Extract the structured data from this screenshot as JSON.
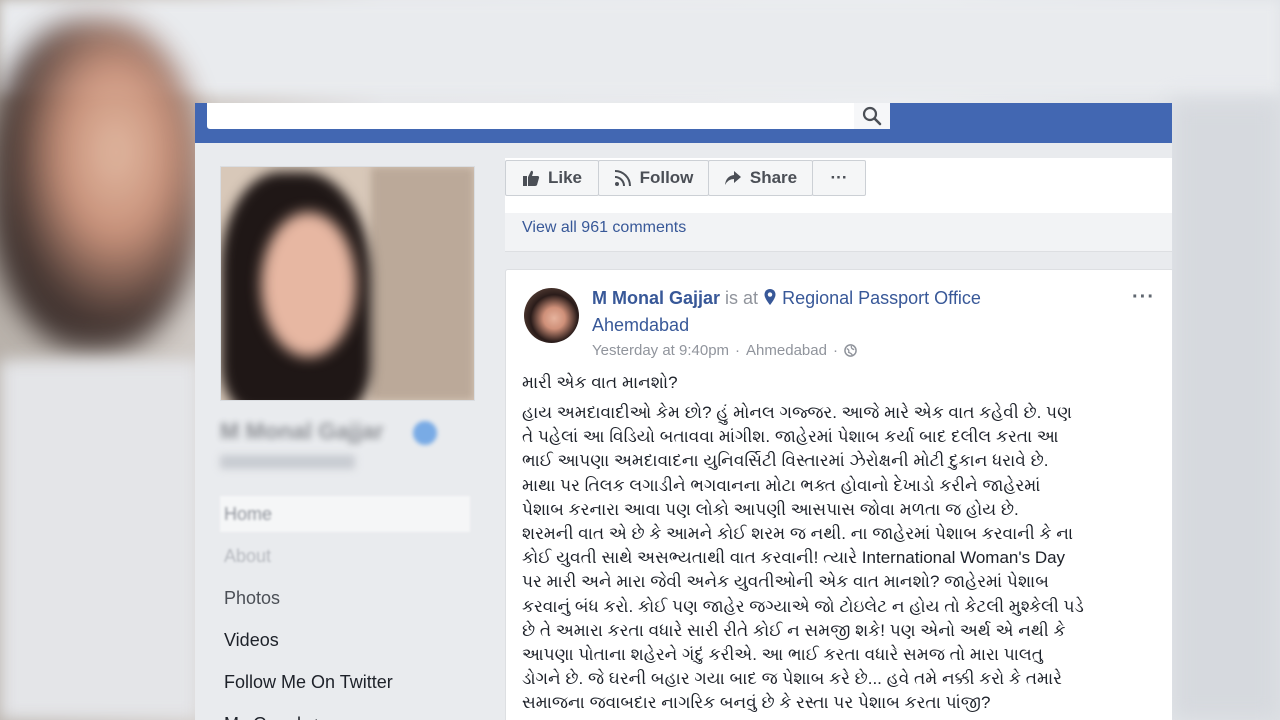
{
  "left_nav": {
    "page_name": "M Monal Gajjar",
    "items": [
      {
        "label": "Home"
      },
      {
        "label": "About"
      },
      {
        "label": "Photos"
      },
      {
        "label": "Videos"
      },
      {
        "label": "Follow Me On Twitter"
      },
      {
        "label": "My Google+"
      }
    ]
  },
  "actions": {
    "like": "Like",
    "follow": "Follow",
    "share": "Share",
    "more": "···"
  },
  "comments": {
    "view_all": "View all 961 comments"
  },
  "post": {
    "author": "M Monal Gajjar",
    "is_at": "is at",
    "place_line1": "Regional Passport Office",
    "place_line2": "Ahemdabad",
    "time": "Yesterday at 9:40pm",
    "location": "Ahmedabad",
    "separator": "·",
    "more": "···",
    "title": "મારી એક વાત માનશો?",
    "lines": [
      "હાય અમદાવાદીઓ કેમ છો? હું મોનલ ગજ્જર. આજે મારે એક વાત કહેવી છે. પણ",
      "તે પહેલાં આ વિડિયો બતાવવા માંગીશ. જાહેરમાં પેશાબ કર્યા બાદ દલીલ કરતા આ",
      "ભાઈ આપણા અમદાવાદના યુનિવર્સિટી વિસ્તારમાં ઝેરોક્ષની મોટી દુકાન ધરાવે છે.",
      "માથા પર તિલક લગાડીને ભગવાનના મોટા ભક્ત હોવાનો દેખાડો કરીને જાહેરમાં",
      "પેશાબ કરનારા આવા પણ લોકો આપણી આસપાસ જોવા મળતા જ હોય છે.",
      "શરમની વાત એ છે કે આમને કોઈ શરમ જ નથી. ના જાહેરમાં પેશાબ કરવાની કે ના",
      "કોઈ યુવતી સાથે અસભ્યતાથી વાત કરવાની! ત્યારે International Woman's Day",
      "પર મારી અને મારા જેવી અનેક યુવતીઓની એક વાત માનશો? જાહેરમાં પેશાબ",
      "કરવાનું બંધ કરો. કોઈ પણ જાહેર જગ્યાએ જો ટોઇલેટ ન હોય તો કેટલી મુશ્કેલી પડે",
      "છે તે અમારા કરતા વધારે સારી રીતે કોઈ ન સમજી શકે! પણ એનો અર્થ એ નથી કે",
      "આપણા પોતાના શહેરને ગંદું કરીએ. આ ભાઈ કરતા વધારે સમજ તો મારા પાલતુ",
      "ડોગને છે. જે ઘરની બહાર ગયા બાદ જ પેશાબ કરે છે... હવે તમે નક્કી કરો કે તમારે",
      "સમાજના જવાબદાર નાગરિક બનવું છે કે રસ્તા પર પેશાબ કરતા પાંજી?"
    ]
  },
  "colors": {
    "facebook_blue": "#4267b2",
    "link_blue": "#385898",
    "meta_gray": "#90949c",
    "background": "#e9ebee"
  },
  "icons": {
    "search": "search-icon",
    "like": "thumbs-up-icon",
    "follow": "rss-icon",
    "share": "share-arrow-icon",
    "location": "map-pin-icon",
    "privacy": "globe-icon"
  }
}
